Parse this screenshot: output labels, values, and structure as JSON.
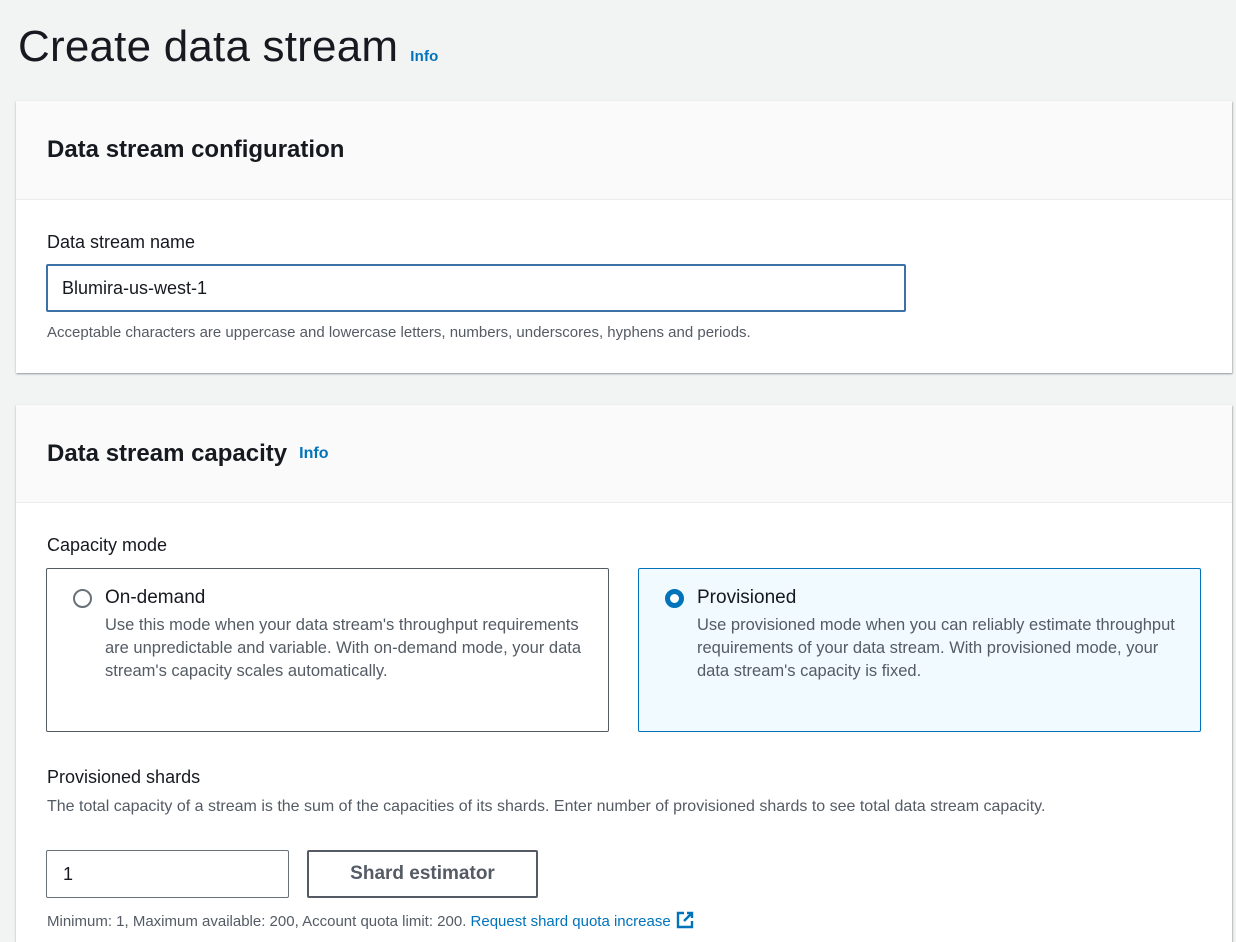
{
  "header": {
    "title": "Create data stream",
    "info_label": "Info"
  },
  "config_panel": {
    "title": "Data stream configuration",
    "name_label": "Data stream name",
    "name_value": "Blumira-us-west-1",
    "name_hint": "Acceptable characters are uppercase and lowercase letters, numbers, underscores, hyphens and periods."
  },
  "capacity_panel": {
    "title": "Data stream capacity",
    "info_label": "Info",
    "mode_label": "Capacity mode",
    "modes": [
      {
        "title": "On-demand",
        "description": "Use this mode when your data stream's throughput requirements are unpredictable and variable. With on-demand mode, your data stream's capacity scales automatically.",
        "selected": false
      },
      {
        "title": "Provisioned",
        "description": "Use provisioned mode when you can reliably estimate throughput requirements of your data stream. With provisioned mode, your data stream's capacity is fixed.",
        "selected": true
      }
    ],
    "shards_label": "Provisioned shards",
    "shards_description": "The total capacity of a stream is the sum of the capacities of its shards. Enter number of provisioned shards to see total data stream capacity.",
    "shards_value": "1",
    "estimator_label": "Shard estimator",
    "shards_hint": "Minimum: 1, Maximum available: 200, Account quota limit: 200.",
    "quota_link": "Request shard quota increase"
  },
  "colors": {
    "accent": "#0073bb",
    "background": "#f2f3f3",
    "selected_tile": "#f1faff"
  }
}
